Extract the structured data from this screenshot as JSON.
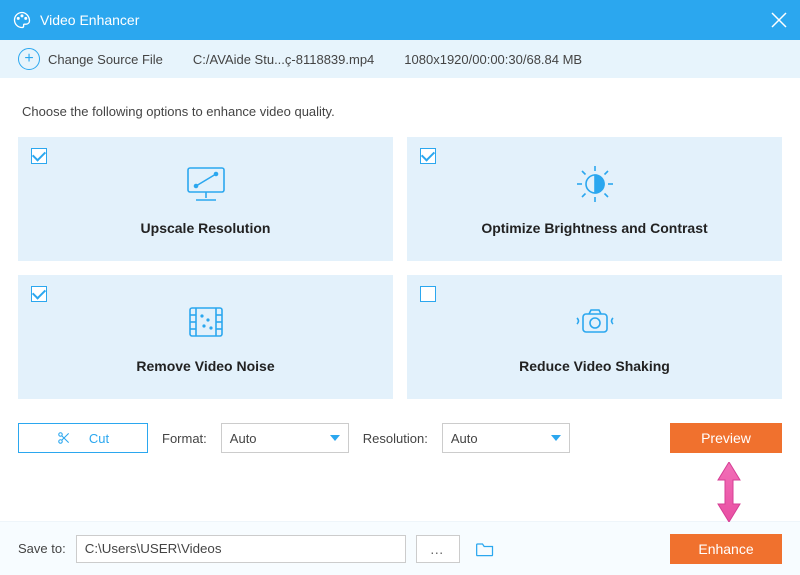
{
  "titlebar": {
    "title": "Video Enhancer"
  },
  "sourcebar": {
    "change_label": "Change Source File",
    "filepath": "C:/AVAide Stu...ç-8118839.mp4",
    "fileinfo": "1080x1920/00:00:30/68.84 MB"
  },
  "instruction": "Choose the following options to enhance video quality.",
  "cards": {
    "upscale": {
      "label": "Upscale Resolution",
      "checked": true
    },
    "brightness": {
      "label": "Optimize Brightness and Contrast",
      "checked": true
    },
    "noise": {
      "label": "Remove Video Noise",
      "checked": true
    },
    "shaking": {
      "label": "Reduce Video Shaking",
      "checked": false
    }
  },
  "controls": {
    "cut_label": "Cut",
    "format_label": "Format:",
    "format_value": "Auto",
    "resolution_label": "Resolution:",
    "resolution_value": "Auto",
    "preview_label": "Preview"
  },
  "footer": {
    "save_label": "Save to:",
    "save_path": "C:\\Users\\USER\\Videos",
    "more": "…",
    "enhance_label": "Enhance"
  }
}
